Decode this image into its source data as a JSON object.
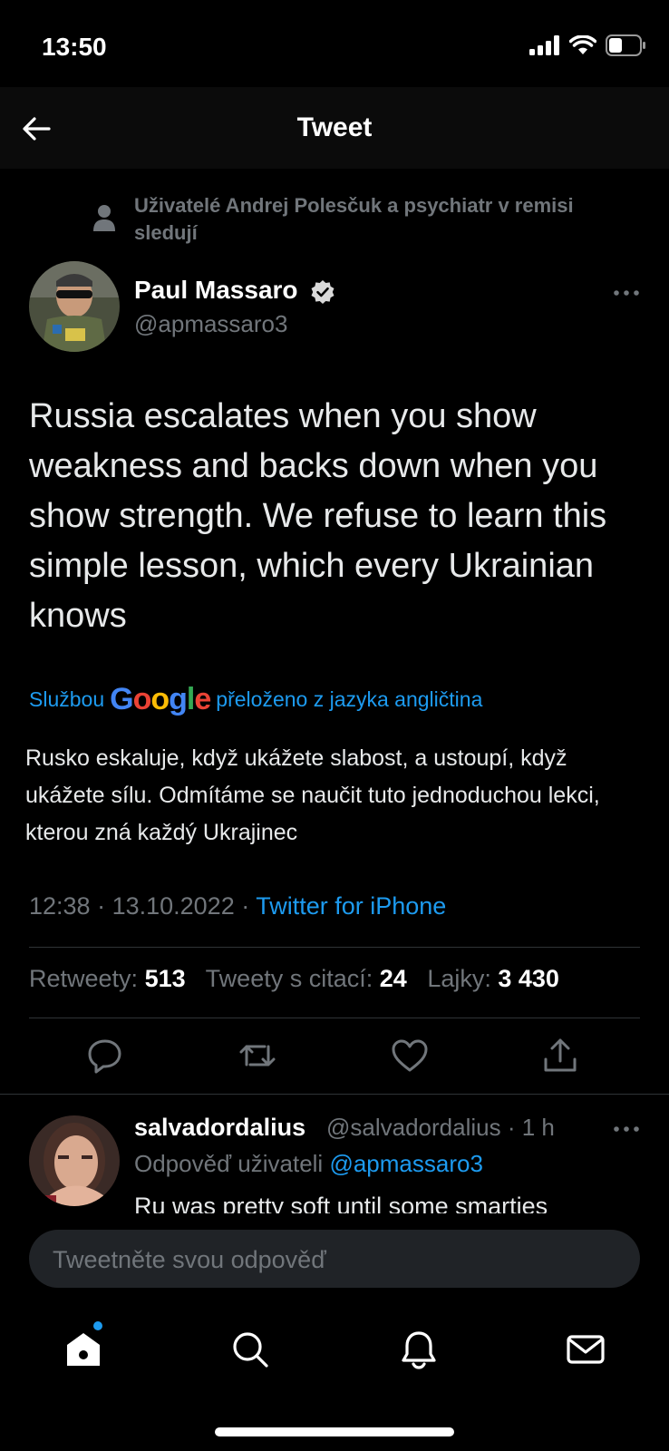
{
  "status_bar": {
    "time": "13:50"
  },
  "header": {
    "title": "Tweet"
  },
  "social_context": {
    "text": "Uživatelé Andrej Polesčuk a psychiatr v remisi sledují"
  },
  "author": {
    "name": "Paul Massaro",
    "handle": "@apmassaro3"
  },
  "tweet": {
    "text": "Russia escalates when you show weakness and backs down when you show strength. We refuse to learn this simple lesson, which every Ukrainian knows",
    "translation_prefix": "Službou",
    "translation_brand": "Google",
    "translation_suffix": "přeloženo z jazyka angličtina",
    "translated_text": "Rusko eskaluje, když ukážete slabost, a ustoupí, když ukážete sílu. Odmítáme se naučit tuto jednoduchou lekci, kterou zná každý Ukrajinec",
    "time": "12:38",
    "date": "13.10.2022",
    "source": "Twitter for iPhone"
  },
  "stats": {
    "retweets_label": "Retweety:",
    "retweets": "513",
    "quotes_label": "Tweety s citací:",
    "quotes": "24",
    "likes_label": "Lajky:",
    "likes": "3 430"
  },
  "reply": {
    "name": "salvadordalius",
    "handle": "@salvadordalius",
    "time": "1 h",
    "reply_to_label": "Odpověď uživateli",
    "reply_to_handle": "@apmassaro3",
    "text": "Ru was pretty soft until some smarties"
  },
  "composer": {
    "placeholder": "Tweetněte svou odpověď"
  },
  "colors": {
    "accent": "#1d9bf0",
    "background": "#000000",
    "secondary_text": "#71767b"
  },
  "icons": [
    "back-arrow-icon",
    "person-icon",
    "verified-badge-icon",
    "more-icon",
    "reply-icon",
    "retweet-icon",
    "like-icon",
    "share-icon",
    "home-icon",
    "search-icon",
    "notifications-icon",
    "messages-icon"
  ]
}
